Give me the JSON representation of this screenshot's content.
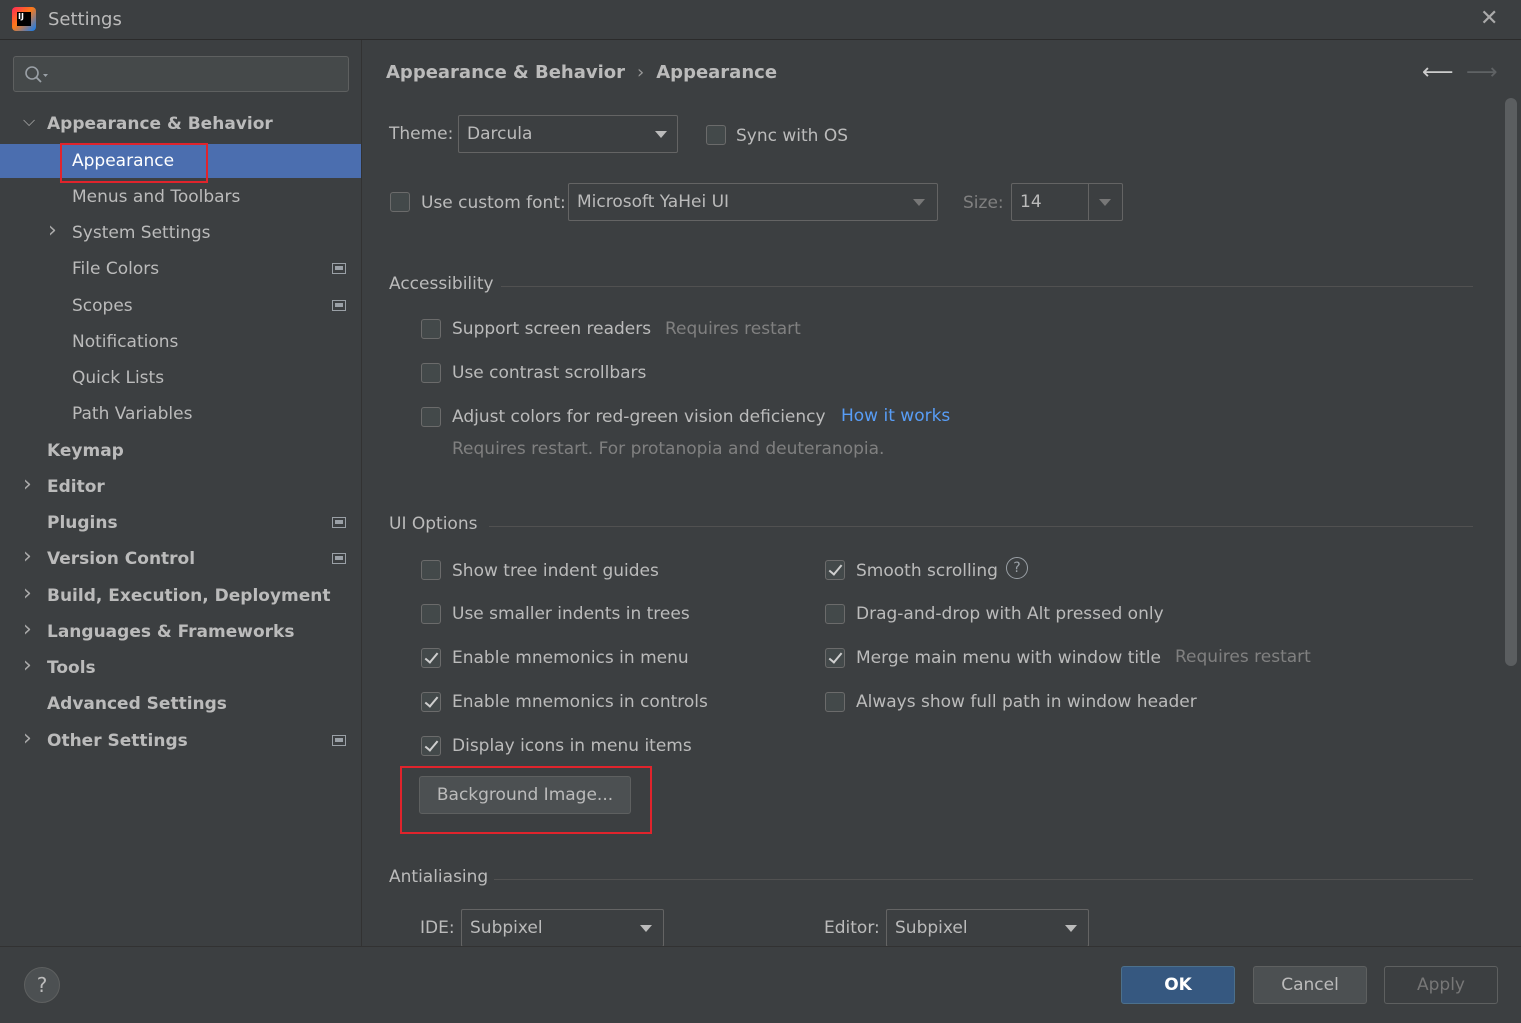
{
  "window": {
    "title": "Settings",
    "logo_text": "IJ"
  },
  "sidebar": {
    "items": [
      {
        "label": "Appearance & Behavior",
        "bold": true,
        "chevron": "down",
        "indent": 0
      },
      {
        "label": "Appearance",
        "bold": false,
        "chevron": "",
        "indent": 1,
        "selected": true
      },
      {
        "label": "Menus and Toolbars",
        "bold": false,
        "chevron": "",
        "indent": 1
      },
      {
        "label": "System Settings",
        "bold": false,
        "chevron": "right",
        "indent": 1
      },
      {
        "label": "File Colors",
        "bold": false,
        "chevron": "",
        "indent": 1,
        "project_icon": true
      },
      {
        "label": "Scopes",
        "bold": false,
        "chevron": "",
        "indent": 1,
        "project_icon": true
      },
      {
        "label": "Notifications",
        "bold": false,
        "chevron": "",
        "indent": 1
      },
      {
        "label": "Quick Lists",
        "bold": false,
        "chevron": "",
        "indent": 1
      },
      {
        "label": "Path Variables",
        "bold": false,
        "chevron": "",
        "indent": 1
      },
      {
        "label": "Keymap",
        "bold": true,
        "chevron": "",
        "indent": 0
      },
      {
        "label": "Editor",
        "bold": true,
        "chevron": "right",
        "indent": 0
      },
      {
        "label": "Plugins",
        "bold": true,
        "chevron": "",
        "indent": 0,
        "project_icon": true
      },
      {
        "label": "Version Control",
        "bold": true,
        "chevron": "right",
        "indent": 0,
        "project_icon": true
      },
      {
        "label": "Build, Execution, Deployment",
        "bold": true,
        "chevron": "right",
        "indent": 0
      },
      {
        "label": "Languages & Frameworks",
        "bold": true,
        "chevron": "right",
        "indent": 0
      },
      {
        "label": "Tools",
        "bold": true,
        "chevron": "right",
        "indent": 0
      },
      {
        "label": "Advanced Settings",
        "bold": true,
        "chevron": "",
        "indent": 0
      },
      {
        "label": "Other Settings",
        "bold": true,
        "chevron": "right",
        "indent": 0,
        "project_icon": true
      }
    ]
  },
  "breadcrumb": {
    "parent": "Appearance & Behavior",
    "separator": "›",
    "current": "Appearance"
  },
  "theme": {
    "label": "Theme:",
    "value": "Darcula",
    "sync_label": "Sync with OS",
    "sync_checked": false
  },
  "font": {
    "use_custom_label": "Use custom font:",
    "checked": false,
    "value": "Microsoft YaHei UI",
    "size_label": "Size:",
    "size_value": "14"
  },
  "accessibility": {
    "title": "Accessibility",
    "screen_readers": {
      "label": "Support screen readers",
      "hint": "Requires restart",
      "checked": false
    },
    "contrast_scrollbars": {
      "label": "Use contrast scrollbars",
      "checked": false
    },
    "red_green": {
      "label": "Adjust colors for red-green vision deficiency",
      "link": "How it works",
      "hint": "Requires restart. For protanopia and deuteranopia.",
      "checked": false
    }
  },
  "ui_options": {
    "title": "UI Options",
    "tree_indent": {
      "label": "Show tree indent guides",
      "checked": false
    },
    "smaller_indents": {
      "label": "Use smaller indents in trees",
      "checked": false
    },
    "mnemonics_menu": {
      "label": "Enable mnemonics in menu",
      "checked": true
    },
    "mnemonics_controls": {
      "label": "Enable mnemonics in controls",
      "checked": true
    },
    "icons_menu": {
      "label": "Display icons in menu items",
      "checked": true
    },
    "smooth_scrolling": {
      "label": "Smooth scrolling",
      "checked": true
    },
    "drag_drop": {
      "label": "Drag-and-drop with Alt pressed only",
      "checked": false
    },
    "merge_menu": {
      "label": "Merge main menu with window title",
      "hint": "Requires restart",
      "checked": true
    },
    "full_path": {
      "label": "Always show full path in window header",
      "checked": false
    },
    "background_image_button": "Background Image..."
  },
  "antialiasing": {
    "title": "Antialiasing",
    "ide_label": "IDE:",
    "ide_value": "Subpixel",
    "editor_label": "Editor:",
    "editor_value": "Subpixel"
  },
  "buttons": {
    "help": "?",
    "ok": "OK",
    "cancel": "Cancel",
    "apply": "Apply"
  },
  "colors": {
    "selection": "#4b6eaf",
    "highlight_box": "#e0242c",
    "link": "#589df6",
    "ok_button": "#365880"
  }
}
